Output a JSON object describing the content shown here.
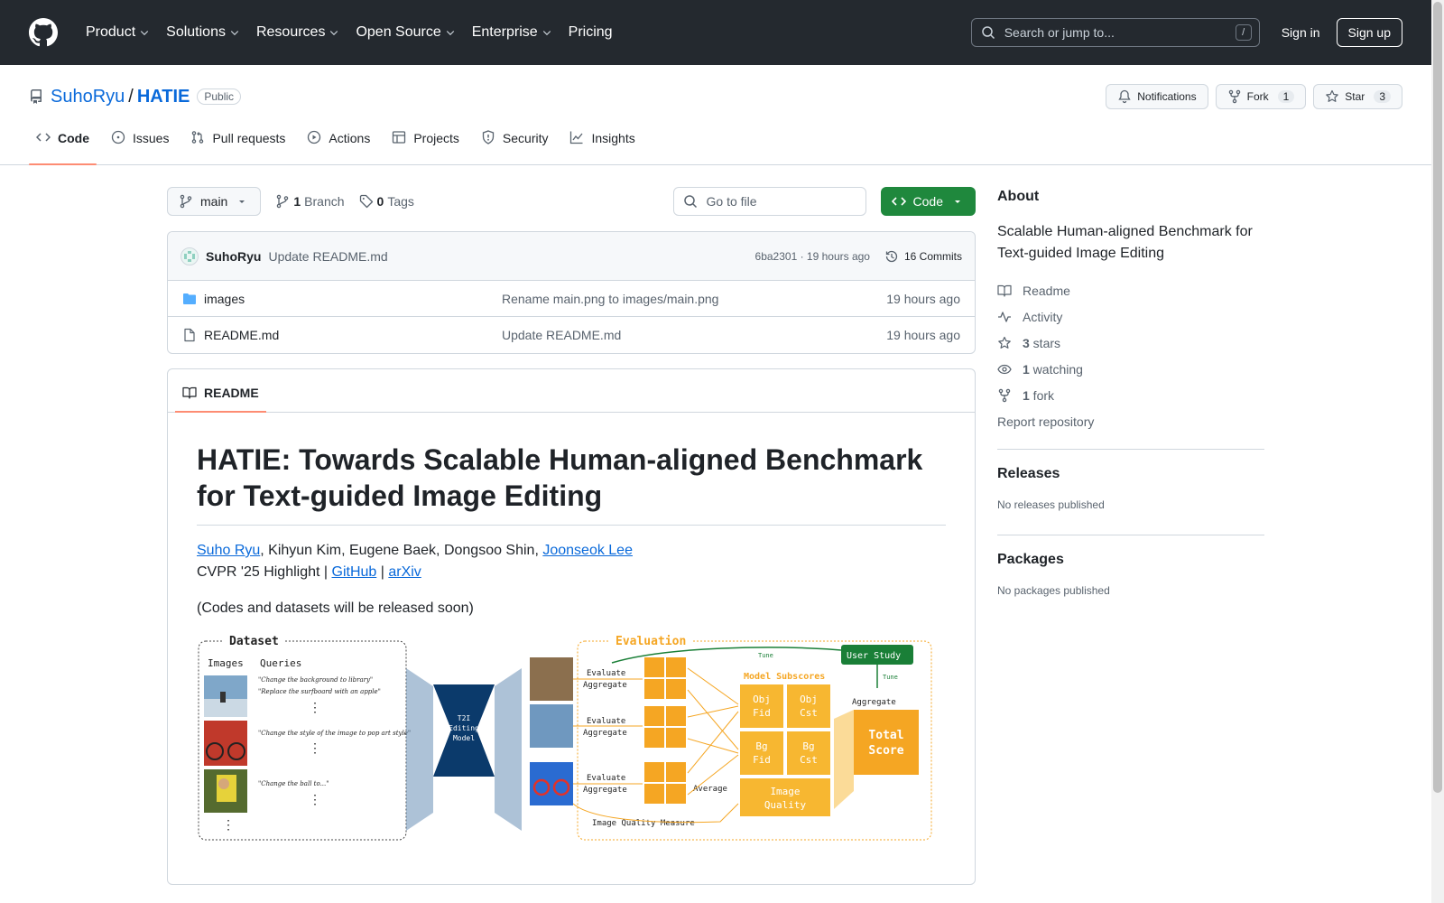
{
  "header": {
    "nav": [
      {
        "label": "Product",
        "has_menu": true
      },
      {
        "label": "Solutions",
        "has_menu": true
      },
      {
        "label": "Resources",
        "has_menu": true
      },
      {
        "label": "Open Source",
        "has_menu": true
      },
      {
        "label": "Enterprise",
        "has_menu": true
      },
      {
        "label": "Pricing",
        "has_menu": false
      }
    ],
    "search_placeholder": "Search or jump to...",
    "search_key": "/",
    "sign_in": "Sign in",
    "sign_up": "Sign up"
  },
  "repo": {
    "owner": "SuhoRyu",
    "separator": "/",
    "name": "HATIE",
    "visibility": "Public",
    "notifications_label": "Notifications",
    "fork_label": "Fork",
    "fork_count": "1",
    "star_label": "Star",
    "star_count": "3",
    "tabs": [
      {
        "label": "Code",
        "icon": "code-icon",
        "active": true
      },
      {
        "label": "Issues",
        "icon": "issue-icon",
        "active": false
      },
      {
        "label": "Pull requests",
        "icon": "pull-request-icon",
        "active": false
      },
      {
        "label": "Actions",
        "icon": "play-icon",
        "active": false
      },
      {
        "label": "Projects",
        "icon": "table-icon",
        "active": false
      },
      {
        "label": "Security",
        "icon": "shield-icon",
        "active": false
      },
      {
        "label": "Insights",
        "icon": "graph-icon",
        "active": false
      }
    ]
  },
  "toolbar": {
    "branch": "main",
    "branch_count": "1",
    "branch_label": "Branch",
    "tag_count": "0",
    "tag_label": "Tags",
    "goto_placeholder": "Go to file",
    "code_button": "Code"
  },
  "latest_commit": {
    "author": "SuhoRyu",
    "message": "Update README.md",
    "sha": "6ba2301",
    "dot": " · ",
    "time": "19 hours ago",
    "commits": "16 Commits"
  },
  "files": [
    {
      "name": "images",
      "type": "folder",
      "commit": "Rename main.png to images/main.png",
      "time": "19 hours ago"
    },
    {
      "name": "README.md",
      "type": "file",
      "commit": "Update README.md",
      "time": "19 hours ago"
    }
  ],
  "readme": {
    "tab_label": "README",
    "title": "HATIE: Towards Scalable Human-aligned Benchmark for Text-guided Image Editing",
    "authors": [
      {
        "name": "Suho Ryu",
        "link": true
      },
      {
        "name": "Kihyun Kim",
        "link": false
      },
      {
        "name": "Eugene Baek",
        "link": false
      },
      {
        "name": "Dongsoo Shin",
        "link": false
      },
      {
        "name": "Joonseok Lee",
        "link": true
      }
    ],
    "venue": "CVPR '25 Highlight | ",
    "github_link": "GitHub",
    "bar": " | ",
    "arxiv_link": "arXiv",
    "note": "(Codes and datasets will be released soon)",
    "figure": {
      "dataset_title": "Dataset",
      "images_header": "Images",
      "queries_header": "Queries",
      "queries": [
        "\"Change the background to library\"",
        "\"Replace the surfboard with an apple\"",
        "\"Change the style of the image to pop art style\"",
        "\"Change the ball to...\""
      ],
      "model_label": [
        "T2I",
        "Editing",
        "Model"
      ],
      "evaluation_title": "Evaluation",
      "evaluate": "Evaluate",
      "aggregate": "Aggregate",
      "average": "Average",
      "tune": "Tune",
      "user_study": "User Study",
      "model_subscores": "Model Subscores",
      "obj_fid": [
        "Obj",
        "Fid"
      ],
      "obj_cst": [
        "Obj",
        "Cst"
      ],
      "bg_fid": [
        "Bg",
        "Fid"
      ],
      "bg_cst": [
        "Bg",
        "Cst"
      ],
      "image_quality": [
        "Image",
        "Quality"
      ],
      "total_score": [
        "Total",
        "Score"
      ],
      "iqm": "Image Quality Measure",
      "vdots": "⋮"
    }
  },
  "about": {
    "title": "About",
    "description": "Scalable Human-aligned Benchmark for Text-guided Image Editing",
    "items": [
      {
        "icon": "book-icon",
        "strong": "",
        "label": "Readme"
      },
      {
        "icon": "pulse-icon",
        "strong": "",
        "label": "Activity"
      },
      {
        "icon": "star-icon",
        "strong": "3",
        "label": " stars"
      },
      {
        "icon": "eye-icon",
        "strong": "1",
        "label": " watching"
      },
      {
        "icon": "fork-icon",
        "strong": "1",
        "label": " fork"
      }
    ],
    "report": "Report repository",
    "releases_title": "Releases",
    "releases_empty": "No releases published",
    "packages_title": "Packages",
    "packages_empty": "No packages published"
  },
  "colors": {
    "header_bg": "#24292f",
    "link": "#0969da",
    "green_button": "#1f883d",
    "tab_underline": "#fd8c73",
    "eval_orange": "#f5a623",
    "model_navy": "#0b3a6b"
  }
}
